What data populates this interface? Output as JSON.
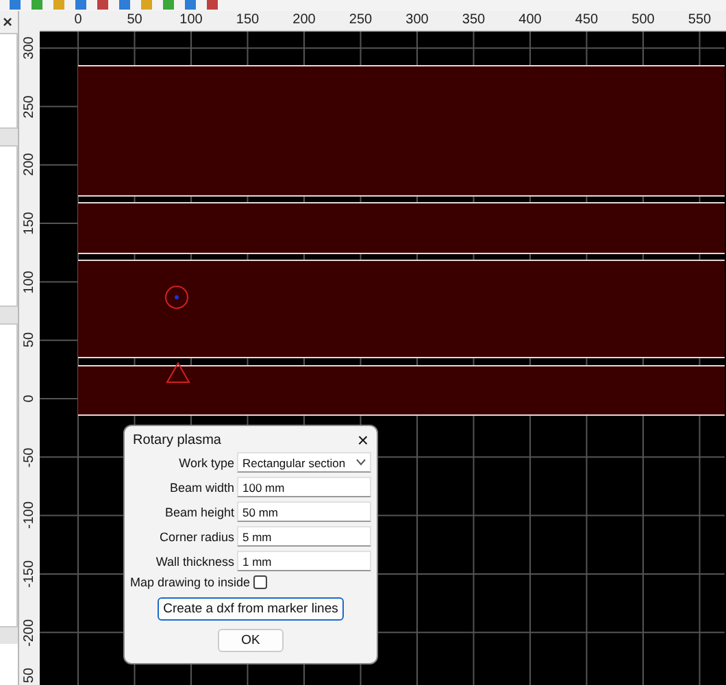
{
  "side_panel": {
    "close": "×"
  },
  "rulers": {
    "x_labels": [
      "0",
      "50",
      "100",
      "150",
      "200",
      "250",
      "300",
      "350",
      "400",
      "450",
      "500",
      "550"
    ],
    "y_labels": [
      "300",
      "250",
      "200",
      "150",
      "100",
      "50",
      "0",
      "-50",
      "-100",
      "-150",
      "-200",
      "50"
    ]
  },
  "dialog": {
    "title": "Rotary plasma",
    "close": "×",
    "fields": [
      {
        "kind": "select",
        "label": "Work type",
        "value": "Rectangular section"
      },
      {
        "kind": "text",
        "label": "Beam width",
        "value": "100 mm"
      },
      {
        "kind": "text",
        "label": "Beam height",
        "value": "50 mm"
      },
      {
        "kind": "text",
        "label": "Corner radius",
        "value": "5 mm"
      },
      {
        "kind": "text",
        "label": "Wall thickness",
        "value": "1 mm"
      }
    ],
    "checkbox": {
      "label": "Map drawing to inside",
      "checked": false
    },
    "action_button": "Create a dxf from marker lines",
    "ok_button": "OK"
  }
}
